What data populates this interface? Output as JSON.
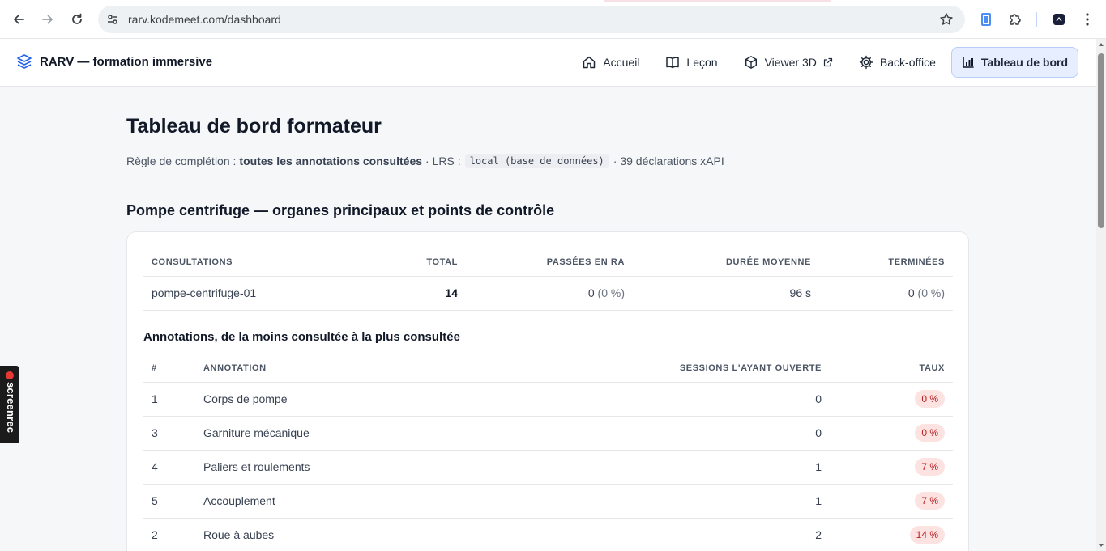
{
  "browser": {
    "url": "rarv.kodemeet.com/dashboard"
  },
  "app": {
    "brand": "RARV — formation immersive",
    "nav": [
      {
        "label": "Accueil",
        "icon": "home-icon"
      },
      {
        "label": "Leçon",
        "icon": "book-icon"
      },
      {
        "label": "Viewer 3D",
        "icon": "cube-icon",
        "external": true
      },
      {
        "label": "Back-office",
        "icon": "gear-icon"
      },
      {
        "label": "Tableau de bord",
        "icon": "bar-chart-icon",
        "active": true
      }
    ]
  },
  "page": {
    "title": "Tableau de bord formateur",
    "meta": {
      "rule_prefix": "Règle de complétion :",
      "rule_value": "toutes les annotations consultées",
      "lrs_prefix": "· LRS :",
      "lrs_value": "local (base de données)",
      "statements": "· 39 déclarations xAPI"
    },
    "section_title": "Pompe centrifuge — organes principaux et points de contrôle"
  },
  "summary_table": {
    "headers": [
      "CONSULTATIONS",
      "TOTAL",
      "PASSÉES EN RA",
      "DURÉE MOYENNE",
      "TERMINÉES"
    ],
    "row": {
      "name": "pompe-centrifuge-01",
      "total": "14",
      "ar_count": "0",
      "ar_pct": "(0 %)",
      "avg_duration": "96 s",
      "done_count": "0",
      "done_pct": "(0 %)"
    }
  },
  "annotations": {
    "title": "Annotations, de la moins consultée à la plus consultée",
    "headers": [
      "#",
      "ANNOTATION",
      "SESSIONS L'AYANT OUVERTE",
      "TAUX"
    ],
    "rows": [
      {
        "n": "1",
        "name": "Corps de pompe",
        "sessions": "0",
        "rate": "0 %"
      },
      {
        "n": "3",
        "name": "Garniture mécanique",
        "sessions": "0",
        "rate": "0 %"
      },
      {
        "n": "4",
        "name": "Paliers et roulements",
        "sessions": "1",
        "rate": "7 %"
      },
      {
        "n": "5",
        "name": "Accouplement",
        "sessions": "1",
        "rate": "7 %"
      },
      {
        "n": "2",
        "name": "Roue à aubes",
        "sessions": "2",
        "rate": "14 %"
      }
    ]
  },
  "overlay": {
    "screenrec_label": "screenrec"
  },
  "colors": {
    "accent": "#2563eb",
    "active_nav_bg": "#e6eeff",
    "rate_pill_bg": "#fde2e2",
    "rate_pill_text": "#b91c1c"
  }
}
